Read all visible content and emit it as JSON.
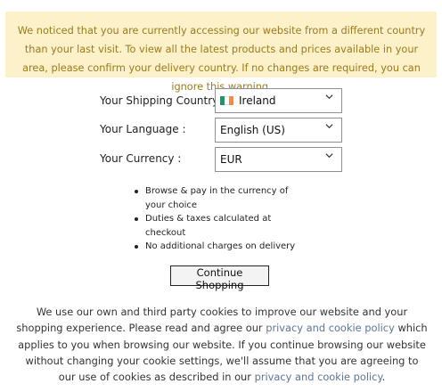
{
  "notice": {
    "text": "We noticed that you are currently accessing our website from a different country than your last visit. To view all the latest products and prices available in your area, please confirm your delivery country. If no changes are required, you can ignore this warning."
  },
  "form": {
    "country_label": "Your Shipping Country :",
    "country_value": "Ireland",
    "country_flag_colors": [
      "#169b62",
      "#ffffff",
      "#ff883e"
    ],
    "language_label": "Your Language :",
    "language_value": "English (US)",
    "currency_label": "Your Currency :",
    "currency_value": "EUR"
  },
  "benefits": [
    "Browse & pay in the currency of your choice",
    "Duties & taxes calculated at checkout",
    "No additional charges on delivery"
  ],
  "continue_label": "Continue Shopping",
  "cookie": {
    "text_before": "We use our own and third party cookies to improve our website and your shopping experience. Please read and agree our ",
    "link1": "privacy and cookie policy",
    "text_middle": " which applies to you when browsing our website. If you continue browsing our website without changing your cookie settings, we'll assume that you are agreeing to our use of cookies as described in our ",
    "link2": "privacy and cookie policy",
    "text_after": "."
  },
  "colors": {
    "notice_bg": "#fcf1c8",
    "notice_text": "#9a7b1f",
    "link": "#5f7595"
  }
}
